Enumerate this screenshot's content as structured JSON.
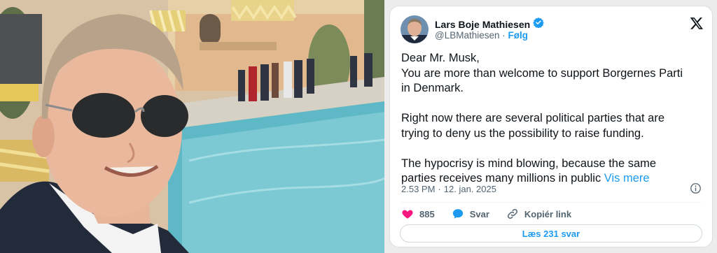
{
  "tweet": {
    "author_name": "Lars Boje Mathiesen",
    "handle": "@LBMathiesen",
    "separator": "·",
    "follow_label": "Følg",
    "text_lines": [
      "Dear Mr. Musk,",
      "You are more than welcome to support Borgernes Parti",
      "in Denmark.",
      "Right now there are several political parties that are",
      "trying to deny us the possibility to raise funding.",
      "The hypocrisy is mind blowing, because the same",
      "parties receives many millions in public"
    ],
    "show_more_label": "Vis mere",
    "time": "2.53 PM",
    "date": "12. jan. 2025",
    "likes": "885",
    "reply_label": "Svar",
    "copy_link_label": "Kopiér link",
    "read_replies_label": "Læs 231 svar"
  },
  "colors": {
    "accent": "#1d9bf0",
    "like": "#f91880",
    "text": "#0f1419",
    "muted": "#536471"
  }
}
